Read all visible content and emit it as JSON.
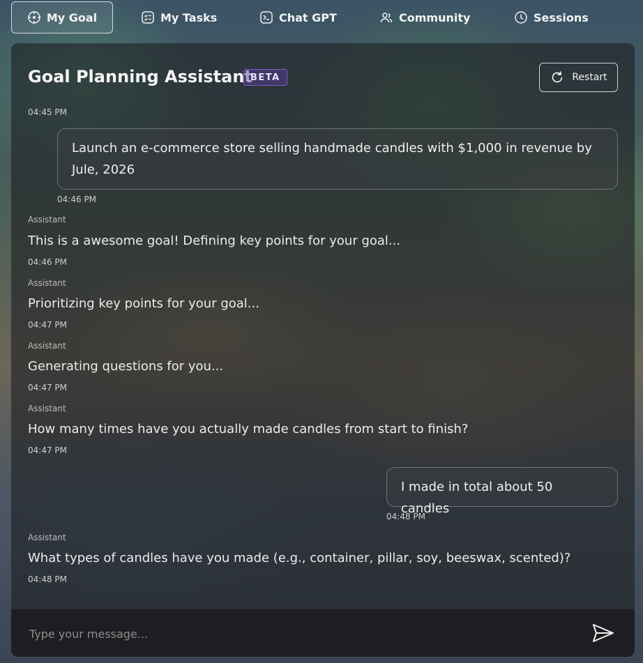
{
  "nav": {
    "items": [
      {
        "label": "My Goal",
        "icon": "target-icon",
        "active": true
      },
      {
        "label": "My Tasks",
        "icon": "tasks-icon",
        "active": false
      },
      {
        "label": "Chat GPT",
        "icon": "terminal-icon",
        "active": false
      },
      {
        "label": "Community",
        "icon": "users-icon",
        "active": false
      },
      {
        "label": "Sessions",
        "icon": "clock-icon",
        "active": false
      }
    ]
  },
  "header": {
    "title": "Goal Planning Assistant",
    "badge": "BETA",
    "restart_label": "Restart"
  },
  "messages": [
    {
      "role": "user",
      "time": "04:45 PM",
      "text": "Launch an e-commerce store selling handmade candles with $1,000 in revenue by",
      "text2": "Jule, 2026",
      "time_after": "04:46 PM"
    },
    {
      "role": "assistant",
      "sender": "Assistant",
      "text": "This is a awesome goal! Defining key points for your goal...",
      "time": "04:46 PM"
    },
    {
      "role": "assistant",
      "sender": "Assistant",
      "text": "Prioritizing key points for your goal...",
      "time": "04:47 PM"
    },
    {
      "role": "assistant",
      "sender": "Assistant",
      "text": "Generating questions for you...",
      "time": "04:47 PM"
    },
    {
      "role": "assistant",
      "sender": "Assistant",
      "text": "How many times have you actually made candles from start to finish?",
      "time": "04:47 PM"
    },
    {
      "role": "user",
      "text": "I made in total about 50 candles",
      "time": "04:48 PM"
    },
    {
      "role": "assistant",
      "sender": "Assistant",
      "text": "What types of candles have you made (e.g., container, pillar, soy, beeswax, scented)?",
      "time": "04:48 PM"
    }
  ],
  "input": {
    "placeholder": "Type your message...",
    "value": ""
  },
  "colors": {
    "beta_border": "#7d5fd0",
    "panel_bg": "rgba(30,32,36,0.62)"
  }
}
